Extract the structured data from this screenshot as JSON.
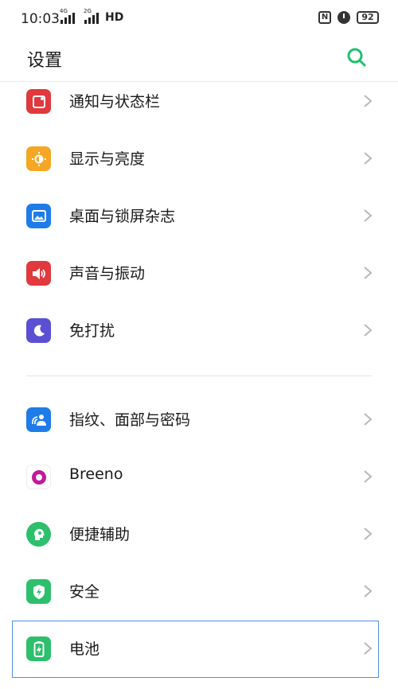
{
  "status_bar": {
    "time": "10:03",
    "signal1_tag": "4G",
    "signal2_tag": "2G",
    "hd_label": "HD",
    "nfc_label": "N",
    "battery_level": "92"
  },
  "header": {
    "title": "设置",
    "search_icon": "search-icon"
  },
  "section1": [
    {
      "label": "通知与状态栏",
      "icon": "notification-icon",
      "color": "#e0393e"
    },
    {
      "label": "显示与亮度",
      "icon": "brightness-icon",
      "color": "#f5a623"
    },
    {
      "label": "桌面与锁屏杂志",
      "icon": "wallpaper-icon",
      "color": "#1e7ce8"
    },
    {
      "label": "声音与振动",
      "icon": "sound-icon",
      "color": "#e0393e"
    },
    {
      "label": "免打扰",
      "icon": "moon-icon",
      "color": "#5b4fd4"
    }
  ],
  "section2": [
    {
      "label": "指纹、面部与密码",
      "icon": "fingerprint-icon",
      "color": "#1e7ce8"
    },
    {
      "label": "Breeno",
      "icon": "breeno-icon",
      "color": "#c4179a"
    },
    {
      "label": "便捷辅助",
      "icon": "assist-icon",
      "color": "#2dbf6c"
    },
    {
      "label": "安全",
      "icon": "shield-icon",
      "color": "#2dbf6c"
    },
    {
      "label": "电池",
      "icon": "battery-icon",
      "color": "#2dbf6c"
    }
  ]
}
